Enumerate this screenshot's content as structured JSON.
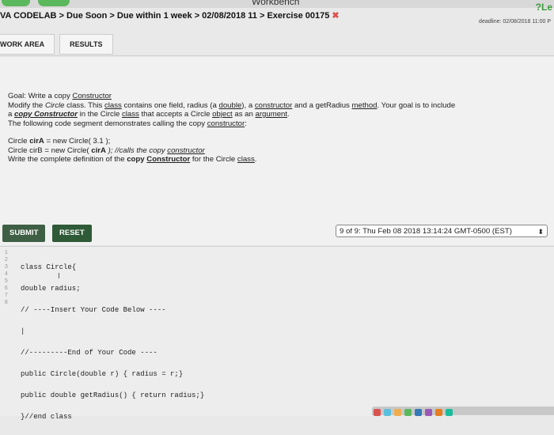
{
  "window": {
    "title": "Workbench",
    "help": "?Le"
  },
  "breadcrumb": {
    "text": "VA CODELAB > Due Soon > Due within 1 week > 02/08/2018 11 > Exercise 00175",
    "close_glyph": "✖"
  },
  "deadline": "deadline: 02/08/2018 11:00 P",
  "tabs": [
    "WORK AREA",
    "RESULTS"
  ],
  "goal": {
    "title_prefix": "Goal: Write a copy ",
    "title_link": "Constructor",
    "l1_a": "Modify the ",
    "l1_b": "Circle",
    "l1_c": " class. This ",
    "l1_d": "class",
    "l1_e": " contains one field, radius (a ",
    "l1_f": "double",
    "l1_g": "), a ",
    "l1_h": "constructor",
    "l1_i": " and a getRadius ",
    "l1_j": "method",
    "l1_k": ". Your goal is to include",
    "l2_a": "a ",
    "l2_b": "copy Constructor",
    "l2_c": " in the Circle ",
    "l2_d": "class",
    "l2_e": " that accepts a Circle ",
    "l2_f": "object",
    "l2_g": " as an ",
    "l2_h": "argument",
    "l2_i": ".",
    "l3_a": "The following code  segment demonstrates calling the copy ",
    "l3_b": "constructor",
    "l3_c": ":",
    "c1_a": "Circle ",
    "c1_b": "cirA",
    "c1_c": "  = new Circle( 3.1 );",
    "c2_a": "Circle cirB  = new Circle( ",
    "c2_b": "cirA",
    "c2_c": " );  //calls the copy ",
    "c2_d": "constructor",
    "l4_a": "Write the complete definition of the ",
    "l4_b": "copy",
    "l4_c": " ",
    "l4_d": "Constructor",
    "l4_e": " for the Circle ",
    "l4_f": "class",
    "l4_g": "."
  },
  "actions": {
    "submit": "SUBMIT",
    "reset": "RESET",
    "submission": "9 of 9: Thu Feb 08 2018 13:14:24 GMT-0500 (EST)",
    "select_arrows": "⬍"
  },
  "editor": {
    "line_numbers": [
      "1",
      "2",
      "3",
      "4",
      "5",
      "6",
      "7",
      "8"
    ],
    "lines": [
      "class Circle{",
      "double radius;",
      "// ----Insert Your Code Below ----",
      "|",
      "//---------End of Your Code ----",
      "public Circle(double r) { radius = r;}",
      "public double getRadius() { return radius;}",
      "}//end class"
    ],
    "cursor_glyph": "I"
  }
}
